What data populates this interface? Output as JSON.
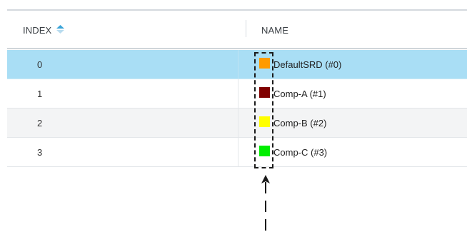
{
  "table": {
    "columns": [
      {
        "label": "INDEX",
        "sort": "ascending"
      },
      {
        "label": "NAME"
      }
    ],
    "rows": [
      {
        "index": "0",
        "name": "DefaultSRD (#0)",
        "color": "#ff9a00",
        "selected": true
      },
      {
        "index": "1",
        "name": "Comp-A (#1)",
        "color": "#800000",
        "selected": false
      },
      {
        "index": "2",
        "name": "Comp-B (#2)",
        "color": "#ffff00",
        "selected": false
      },
      {
        "index": "3",
        "name": "Comp-C (#3)",
        "color": "#00ee00",
        "selected": false
      }
    ]
  },
  "colors": {
    "selected_row": "#a9def5",
    "sort_icon": "#3aa4d8",
    "annotation": "#1a1a1a"
  },
  "icons": {
    "sort": "sort-ascending-icon",
    "annotation_arrow": "arrow-up-icon"
  }
}
